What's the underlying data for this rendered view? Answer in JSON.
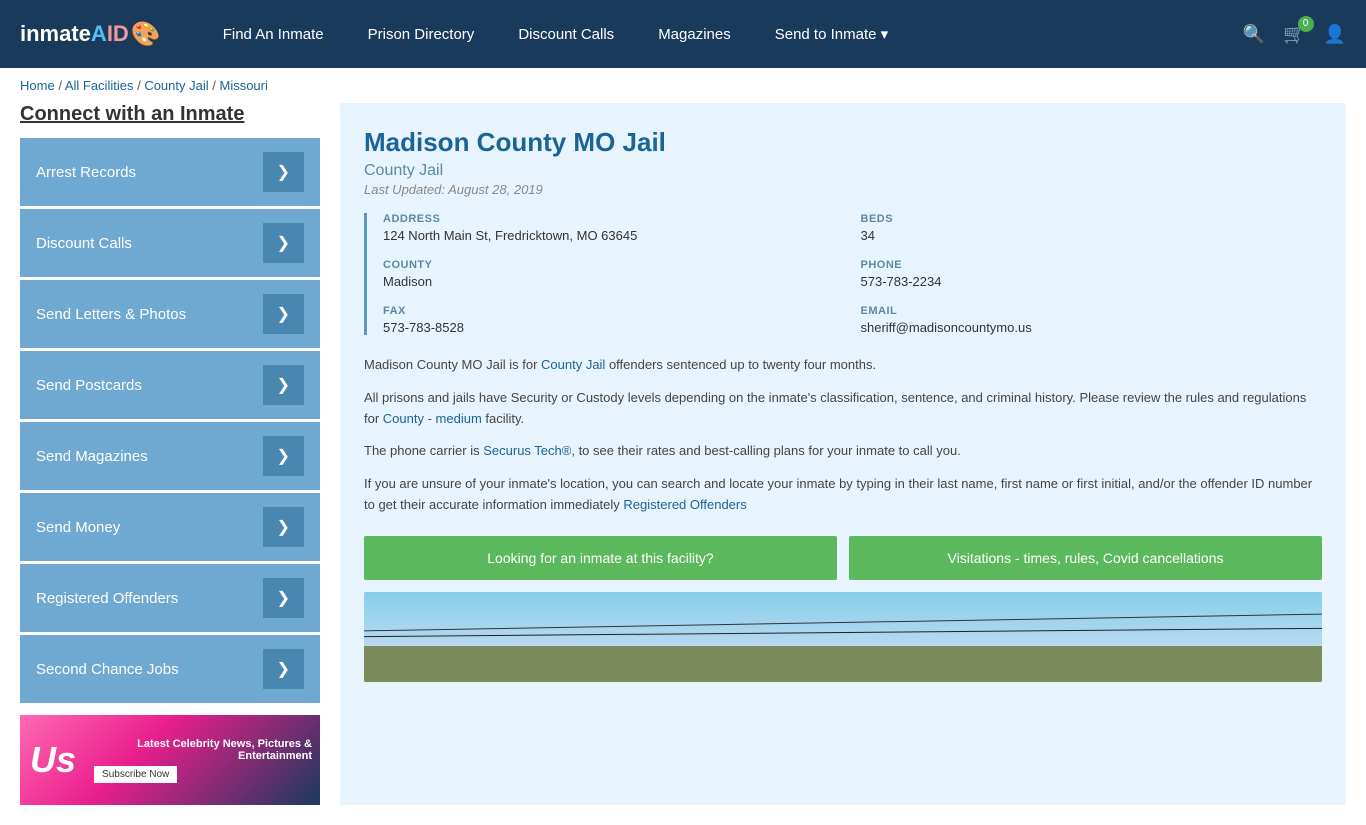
{
  "header": {
    "logo": "inmateAID",
    "logo_emoji": "🎨",
    "nav": [
      {
        "label": "Find An Inmate",
        "id": "find-inmate"
      },
      {
        "label": "Prison Directory",
        "id": "prison-directory"
      },
      {
        "label": "Discount Calls",
        "id": "discount-calls"
      },
      {
        "label": "Magazines",
        "id": "magazines"
      },
      {
        "label": "Send to Inmate ▾",
        "id": "send-to-inmate"
      }
    ],
    "cart_count": "0"
  },
  "breadcrumb": {
    "home": "Home",
    "all_facilities": "All Facilities",
    "county_jail": "County Jail",
    "state": "Missouri"
  },
  "sidebar": {
    "title": "Connect with an Inmate",
    "items": [
      {
        "label": "Arrest Records",
        "id": "arrest-records"
      },
      {
        "label": "Discount Calls",
        "id": "discount-calls"
      },
      {
        "label": "Send Letters & Photos",
        "id": "send-letters"
      },
      {
        "label": "Send Postcards",
        "id": "send-postcards"
      },
      {
        "label": "Send Magazines",
        "id": "send-magazines"
      },
      {
        "label": "Send Money",
        "id": "send-money"
      },
      {
        "label": "Registered Offenders",
        "id": "registered-offenders"
      },
      {
        "label": "Second Chance Jobs",
        "id": "second-chance-jobs"
      }
    ]
  },
  "ad": {
    "logo": "Us",
    "title": "Latest Celebrity News, Pictures & Entertainment",
    "button": "Subscribe Now"
  },
  "facility": {
    "title": "Madison County MO Jail",
    "subtitle": "County Jail",
    "last_updated": "Last Updated: August 28, 2019",
    "address_label": "ADDRESS",
    "address_value": "124 North Main St, Fredricktown, MO 63645",
    "beds_label": "BEDS",
    "beds_value": "34",
    "county_label": "COUNTY",
    "county_value": "Madison",
    "phone_label": "PHONE",
    "phone_value": "573-783-2234",
    "fax_label": "FAX",
    "fax_value": "573-783-8528",
    "email_label": "EMAIL",
    "email_value": "sheriff@madisoncountymo.us",
    "desc1": "Madison County MO Jail is for County Jail offenders sentenced up to twenty four months.",
    "desc1_link": "County Jail",
    "desc2": "All prisons and jails have Security or Custody levels depending on the inmate's classification, sentence, and criminal history. Please review the rules and regulations for County - medium facility.",
    "desc2_link": "County - medium",
    "desc3": "The phone carrier is Securus Tech®, to see their rates and best-calling plans for your inmate to call you.",
    "desc3_link": "Securus Tech®",
    "desc4": "If you are unsure of your inmate's location, you can search and locate your inmate by typing in their last name, first name or first initial, and/or the offender ID number to get their accurate information immediately Registered Offenders",
    "desc4_link": "Registered Offenders",
    "btn1": "Looking for an inmate at this facility?",
    "btn2": "Visitations - times, rules, Covid cancellations"
  }
}
